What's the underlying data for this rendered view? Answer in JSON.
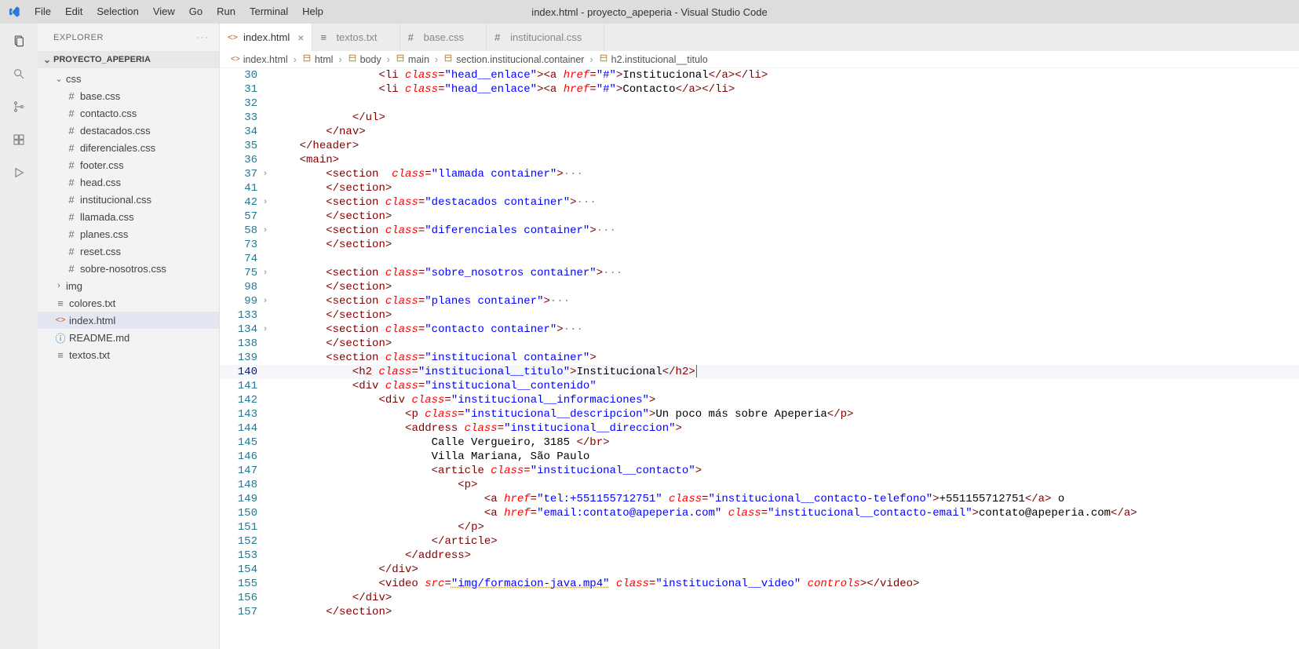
{
  "window": {
    "title": "index.html - proyecto_apeperia - Visual Studio Code"
  },
  "menu": [
    "File",
    "Edit",
    "Selection",
    "View",
    "Go",
    "Run",
    "Terminal",
    "Help"
  ],
  "sidebar": {
    "title": "EXPLORER",
    "actions": "···",
    "project": "PROYECTO_APEPERIA",
    "tree": [
      {
        "type": "folder",
        "depth": 1,
        "chev": "▾",
        "label": "css"
      },
      {
        "type": "file",
        "depth": 2,
        "icon": "#",
        "label": "base.css"
      },
      {
        "type": "file",
        "depth": 2,
        "icon": "#",
        "label": "contacto.css"
      },
      {
        "type": "file",
        "depth": 2,
        "icon": "#",
        "label": "destacados.css"
      },
      {
        "type": "file",
        "depth": 2,
        "icon": "#",
        "label": "diferenciales.css"
      },
      {
        "type": "file",
        "depth": 2,
        "icon": "#",
        "label": "footer.css"
      },
      {
        "type": "file",
        "depth": 2,
        "icon": "#",
        "label": "head.css"
      },
      {
        "type": "file",
        "depth": 2,
        "icon": "#",
        "label": "institucional.css"
      },
      {
        "type": "file",
        "depth": 2,
        "icon": "#",
        "label": "llamada.css"
      },
      {
        "type": "file",
        "depth": 2,
        "icon": "#",
        "label": "planes.css"
      },
      {
        "type": "file",
        "depth": 2,
        "icon": "#",
        "label": "reset.css"
      },
      {
        "type": "file",
        "depth": 2,
        "icon": "#",
        "label": "sobre-nosotros.css"
      },
      {
        "type": "folder",
        "depth": 1,
        "chev": "›",
        "label": "img"
      },
      {
        "type": "file",
        "depth": 1,
        "icon": "≡",
        "label": "colores.txt"
      },
      {
        "type": "file",
        "depth": 1,
        "icon": "<>",
        "label": "index.html",
        "selected": true
      },
      {
        "type": "file",
        "depth": 1,
        "icon": "ⓘ",
        "label": "README.md"
      },
      {
        "type": "file",
        "depth": 1,
        "icon": "≡",
        "label": "textos.txt"
      }
    ]
  },
  "tabs": [
    {
      "icon": "<>",
      "label": "index.html",
      "active": true,
      "close": "×"
    },
    {
      "icon": "≡",
      "label": "textos.txt",
      "active": false,
      "close": ""
    },
    {
      "icon": "#",
      "label": "base.css",
      "active": false,
      "close": ""
    },
    {
      "icon": "#",
      "label": "institucional.css",
      "active": false,
      "close": ""
    }
  ],
  "breadcrumbs": [
    {
      "icon": "<>",
      "label": "index.html"
    },
    {
      "icon": "⊞",
      "label": "html"
    },
    {
      "icon": "⊞",
      "label": "body"
    },
    {
      "icon": "⊞",
      "label": "main"
    },
    {
      "icon": "⊞",
      "label": "section.institucional.container"
    },
    {
      "icon": "⊞",
      "label": "h2.institucional__titulo"
    }
  ],
  "code": {
    "lines": [
      {
        "n": 30,
        "html": "                <span class='p'>&lt;</span><span class='t'>li</span> <span class='ai'>class</span><span class='p'>=</span><span class='s'>\"head__enlace\"</span><span class='p'>&gt;&lt;</span><span class='t'>a</span> <span class='ai'>href</span><span class='p'>=</span><span class='s'>\"#\"</span><span class='p'>&gt;</span><span class='tx'>Institucional</span><span class='p'>&lt;/</span><span class='t'>a</span><span class='p'>&gt;&lt;/</span><span class='t'>li</span><span class='p'>&gt;</span>"
      },
      {
        "n": 31,
        "html": "                <span class='p'>&lt;</span><span class='t'>li</span> <span class='ai'>class</span><span class='p'>=</span><span class='s'>\"head__enlace\"</span><span class='p'>&gt;&lt;</span><span class='t'>a</span> <span class='ai'>href</span><span class='p'>=</span><span class='s'>\"#\"</span><span class='p'>&gt;</span><span class='tx'>Contacto</span><span class='p'>&lt;/</span><span class='t'>a</span><span class='p'>&gt;&lt;/</span><span class='t'>li</span><span class='p'>&gt;</span>"
      },
      {
        "n": 32,
        "html": ""
      },
      {
        "n": 33,
        "html": "            <span class='p'>&lt;/</span><span class='t'>ul</span><span class='p'>&gt;</span>"
      },
      {
        "n": 34,
        "html": "        <span class='p'>&lt;/</span><span class='t'>nav</span><span class='p'>&gt;</span>"
      },
      {
        "n": 35,
        "html": "    <span class='p'>&lt;/</span><span class='t'>header</span><span class='p'>&gt;</span>"
      },
      {
        "n": 36,
        "html": "    <span class='p'>&lt;</span><span class='t'>main</span><span class='p'>&gt;</span>"
      },
      {
        "n": 37,
        "fold": "›",
        "html": "        <span class='p'>&lt;</span><span class='t'>section</span>  <span class='ai'>class</span><span class='p'>=</span><span class='s'>\"llamada container\"</span><span class='p'>&gt;</span><span class='dots'>&middot;&middot;&middot;</span>"
      },
      {
        "n": 41,
        "html": "        <span class='p'>&lt;/</span><span class='t'>section</span><span class='p'>&gt;</span>"
      },
      {
        "n": 42,
        "fold": "›",
        "html": "        <span class='p'>&lt;</span><span class='t'>section</span> <span class='ai'>class</span><span class='p'>=</span><span class='s'>\"destacados container\"</span><span class='p'>&gt;</span><span class='dots'>&middot;&middot;&middot;</span>"
      },
      {
        "n": 57,
        "html": "        <span class='p'>&lt;/</span><span class='t'>section</span><span class='p'>&gt;</span>"
      },
      {
        "n": 58,
        "fold": "›",
        "html": "        <span class='p'>&lt;</span><span class='t'>section</span> <span class='ai'>class</span><span class='p'>=</span><span class='s'>\"diferenciales container\"</span><span class='p'>&gt;</span><span class='dots'>&middot;&middot;&middot;</span>"
      },
      {
        "n": 73,
        "html": "        <span class='p'>&lt;/</span><span class='t'>section</span><span class='p'>&gt;</span>"
      },
      {
        "n": 74,
        "html": ""
      },
      {
        "n": 75,
        "fold": "›",
        "html": "        <span class='p'>&lt;</span><span class='t'>section</span> <span class='ai'>class</span><span class='p'>=</span><span class='s'>\"sobre_nosotros container\"</span><span class='p'>&gt;</span><span class='dots'>&middot;&middot;&middot;</span>"
      },
      {
        "n": 98,
        "html": "        <span class='p'>&lt;/</span><span class='t'>section</span><span class='p'>&gt;</span>"
      },
      {
        "n": 99,
        "fold": "›",
        "html": "        <span class='p'>&lt;</span><span class='t'>section</span> <span class='ai'>class</span><span class='p'>=</span><span class='s'>\"planes container\"</span><span class='p'>&gt;</span><span class='dots'>&middot;&middot;&middot;</span>"
      },
      {
        "n": 133,
        "html": "        <span class='p'>&lt;/</span><span class='t'>section</span><span class='p'>&gt;</span>"
      },
      {
        "n": 134,
        "fold": "›",
        "html": "        <span class='p'>&lt;</span><span class='t'>section</span> <span class='ai'>class</span><span class='p'>=</span><span class='s'>\"contacto container\"</span><span class='p'>&gt;</span><span class='dots'>&middot;&middot;&middot;</span>"
      },
      {
        "n": 138,
        "html": "        <span class='p'>&lt;/</span><span class='t'>section</span><span class='p'>&gt;</span>"
      },
      {
        "n": 139,
        "html": "        <span class='p'>&lt;</span><span class='t'>section</span> <span class='ai'>class</span><span class='p'>=</span><span class='s'>\"institucional container\"</span><span class='p'>&gt;</span>"
      },
      {
        "n": 140,
        "current": true,
        "html": "            <span class='p'>&lt;</span><span class='t'>h2</span> <span class='ai'>class</span><span class='p'>=</span><span class='s'>\"institucional__titulo\"</span><span class='p'>&gt;</span><span class='tx'>Institucional</span><span class='p'>&lt;/</span><span class='t'>h2</span><span class='p'>&gt;</span><span class='cursor'></span>"
      },
      {
        "n": 141,
        "html": "            <span class='p'>&lt;</span><span class='t'>div</span> <span class='ai'>class</span><span class='p'>=</span><span class='s'>\"institucional__contenido\"</span>"
      },
      {
        "n": 142,
        "html": "                <span class='p'>&lt;</span><span class='t'>div</span> <span class='ai'>class</span><span class='p'>=</span><span class='s'>\"institucional__informaciones\"</span><span class='p'>&gt;</span>"
      },
      {
        "n": 143,
        "html": "                    <span class='p'>&lt;</span><span class='t'>p</span> <span class='ai'>class</span><span class='p'>=</span><span class='s'>\"institucional__descripcion\"</span><span class='p'>&gt;</span><span class='tx'>Un poco más sobre Apeperia</span><span class='p'>&lt;/</span><span class='t'>p</span><span class='p'>&gt;</span>"
      },
      {
        "n": 144,
        "html": "                    <span class='p'>&lt;</span><span class='t'>address</span> <span class='ai'>class</span><span class='p'>=</span><span class='s'>\"institucional__direccion\"</span><span class='p'>&gt;</span>"
      },
      {
        "n": 145,
        "html": "                        <span class='tx'>Calle Vergueiro, 3185 </span><span class='p'>&lt;/</span><span class='t'>br</span><span class='p'>&gt;</span>"
      },
      {
        "n": 146,
        "html": "                        <span class='tx'>Villa Mariana, São Paulo</span>"
      },
      {
        "n": 147,
        "html": "                        <span class='p'>&lt;</span><span class='t'>article</span> <span class='ai'>class</span><span class='p'>=</span><span class='s'>\"institucional__contacto\"</span><span class='p'>&gt;</span>"
      },
      {
        "n": 148,
        "html": "                            <span class='p'>&lt;</span><span class='t'>p</span><span class='p'>&gt;</span>"
      },
      {
        "n": 149,
        "html": "                                <span class='p'>&lt;</span><span class='t'>a</span> <span class='ai'>href</span><span class='p'>=</span><span class='s'>\"tel:+551155712751\"</span> <span class='ai'>class</span><span class='p'>=</span><span class='s'>\"institucional__contacto-telefono\"</span><span class='p'>&gt;</span><span class='tx'>+551155712751</span><span class='p'>&lt;/</span><span class='t'>a</span><span class='p'>&gt;</span><span class='tx'> o</span>"
      },
      {
        "n": 150,
        "html": "                                <span class='p'>&lt;</span><span class='t'>a</span> <span class='ai'>href</span><span class='p'>=</span><span class='s'>\"email:contato@apeperia.com\"</span> <span class='ai'>class</span><span class='p'>=</span><span class='s'>\"institucional__contacto-email\"</span><span class='p'>&gt;</span><span class='tx'>contato@apeperia.com</span><span class='p'>&lt;/</span><span class='t'>a</span><span class='p'>&gt;</span>"
      },
      {
        "n": 151,
        "html": "                            <span class='p'>&lt;/</span><span class='t'>p</span><span class='p'>&gt;</span>"
      },
      {
        "n": 152,
        "html": "                        <span class='p'>&lt;/</span><span class='t'>article</span><span class='p'>&gt;</span>"
      },
      {
        "n": 153,
        "html": "                    <span class='p'>&lt;/</span><span class='t'>address</span><span class='p'>&gt;</span>"
      },
      {
        "n": 154,
        "html": "                <span class='p'>&lt;/</span><span class='t'>div</span><span class='p'>&gt;</span>"
      },
      {
        "n": 155,
        "html": "                <span class='p'>&lt;</span><span class='t'>video</span> <span class='ai'>src</span><span class='p'>=</span><span class='s underline'>\"img/formacion-java.mp4\"</span> <span class='ai'>class</span><span class='p'>=</span><span class='s'>\"institucional__video\"</span> <span class='ai'>controls</span><span class='p'>&gt;&lt;/</span><span class='t'>video</span><span class='p'>&gt;</span>"
      },
      {
        "n": 156,
        "html": "            <span class='p'>&lt;/</span><span class='t'>div</span><span class='p'>&gt;</span>"
      },
      {
        "n": 157,
        "html": "        <span class='p'>&lt;/</span><span class='t'>section</span><span class='p'>&gt;</span>"
      }
    ]
  }
}
